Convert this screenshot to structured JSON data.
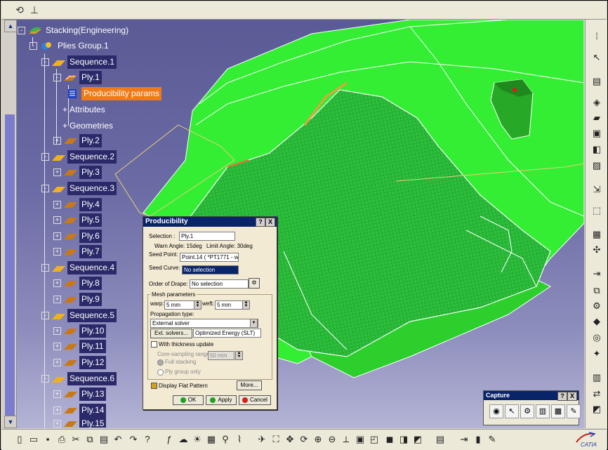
{
  "tree": {
    "root": "Stacking(Engineering)",
    "group": "Plies Group.1",
    "nodes": [
      {
        "label": "Sequence.1"
      },
      {
        "label": "Ply.1"
      },
      {
        "label": "Producibility params"
      },
      {
        "label": "Attributes"
      },
      {
        "label": "Geometries"
      },
      {
        "label": "Ply.2"
      },
      {
        "label": "Sequence.2"
      },
      {
        "label": "Ply.3"
      },
      {
        "label": "Sequence.3"
      },
      {
        "label": "Ply.4"
      },
      {
        "label": "Ply.5"
      },
      {
        "label": "Ply.6"
      },
      {
        "label": "Ply.7"
      },
      {
        "label": "Sequence.4"
      },
      {
        "label": "Ply.8"
      },
      {
        "label": "Ply.9"
      },
      {
        "label": "Sequence.5"
      },
      {
        "label": "Ply.10"
      },
      {
        "label": "Ply.11"
      },
      {
        "label": "Ply.12"
      },
      {
        "label": "Sequence.6"
      },
      {
        "label": "Ply.13"
      },
      {
        "label": "Ply.14"
      },
      {
        "label": "Ply.15"
      }
    ]
  },
  "dialog": {
    "title": "Producibility",
    "help_btn": "?",
    "close_btn": "X",
    "selection_label": "Selection :",
    "selection_value": "Ply.1",
    "warn_angle": "Warn Angle: 15deg",
    "limit_angle": "Limit Angle: 30deg",
    "seed_point_label": "Seed Point:",
    "seed_point_value": "Point.14 ( *PT1771 - w",
    "seed_curve_label": "Seed Curve:",
    "seed_curve_value": "No selection",
    "order_label": "Order of Drape:",
    "order_value": "No selection",
    "mesh_group": "Mesh parameters",
    "warp_label": "warp:",
    "warp_value": "5 mm",
    "weft_label": "weft:",
    "weft_value": "5 mm",
    "prop_label": "Propagation type:",
    "prop_value": "External solver",
    "ext_solvers_btn": "Ext. solvers...",
    "solver_value": "Optimized Energy (SLT)",
    "thickness_label": "With thickness update",
    "core_label": "Core-sampling range",
    "core_value": "50 mm",
    "full_stacking": "Full stacking",
    "ply_group_only": "Ply group only",
    "flat_pattern": "Display Flat Pattern",
    "more_btn": "More...",
    "ok_btn": "OK",
    "apply_btn": "Apply",
    "cancel_btn": "Cancel"
  },
  "capture": {
    "title": "Capture",
    "help_btn": "?",
    "close_btn": "X"
  },
  "brand": {
    "catia": "CATIA"
  },
  "colors": {
    "selected": "#f07a18",
    "title_bar": "#0a246a",
    "model_green": "#33ee33"
  }
}
